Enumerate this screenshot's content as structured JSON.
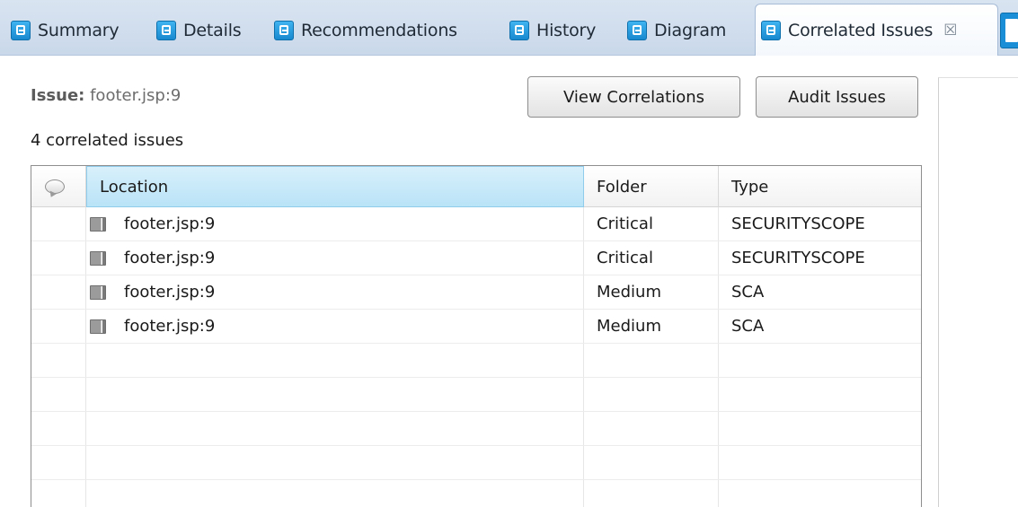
{
  "tabs": [
    {
      "label": "Summary",
      "icon": "tab-doc-icon",
      "active": false
    },
    {
      "label": "Details",
      "icon": "tab-doc-icon",
      "active": false
    },
    {
      "label": "Recommendations",
      "icon": "tab-doc-icon",
      "active": false
    },
    {
      "label": "History",
      "icon": "tab-doc-icon",
      "active": false
    },
    {
      "label": "Diagram",
      "icon": "tab-doc-icon",
      "active": false
    },
    {
      "label": "Correlated Issues",
      "icon": "tab-doc-icon",
      "active": true,
      "close_glyph": "☒"
    }
  ],
  "issue": {
    "label": "Issue:",
    "value": "footer.jsp:9"
  },
  "correlated_count_text": "4 correlated issues",
  "buttons": {
    "view_correlations": "View Correlations",
    "audit_issues": "Audit Issues"
  },
  "table": {
    "columns": [
      "",
      "Location",
      "Folder",
      "Type"
    ],
    "sorted_column": "Location",
    "rows": [
      {
        "location": "footer.jsp:9",
        "folder": "Critical",
        "type": "SECURITYSCOPE"
      },
      {
        "location": "footer.jsp:9",
        "folder": "Critical",
        "type": "SECURITYSCOPE"
      },
      {
        "location": "footer.jsp:9",
        "folder": "Medium",
        "type": "SCA"
      },
      {
        "location": "footer.jsp:9",
        "folder": "Medium",
        "type": "SCA"
      }
    ],
    "empty_rows": 5
  },
  "colors": {
    "accent": "#1a8fd8",
    "tabbar": "#c9d8ea",
    "sorted_header": "#b9e3f7"
  }
}
